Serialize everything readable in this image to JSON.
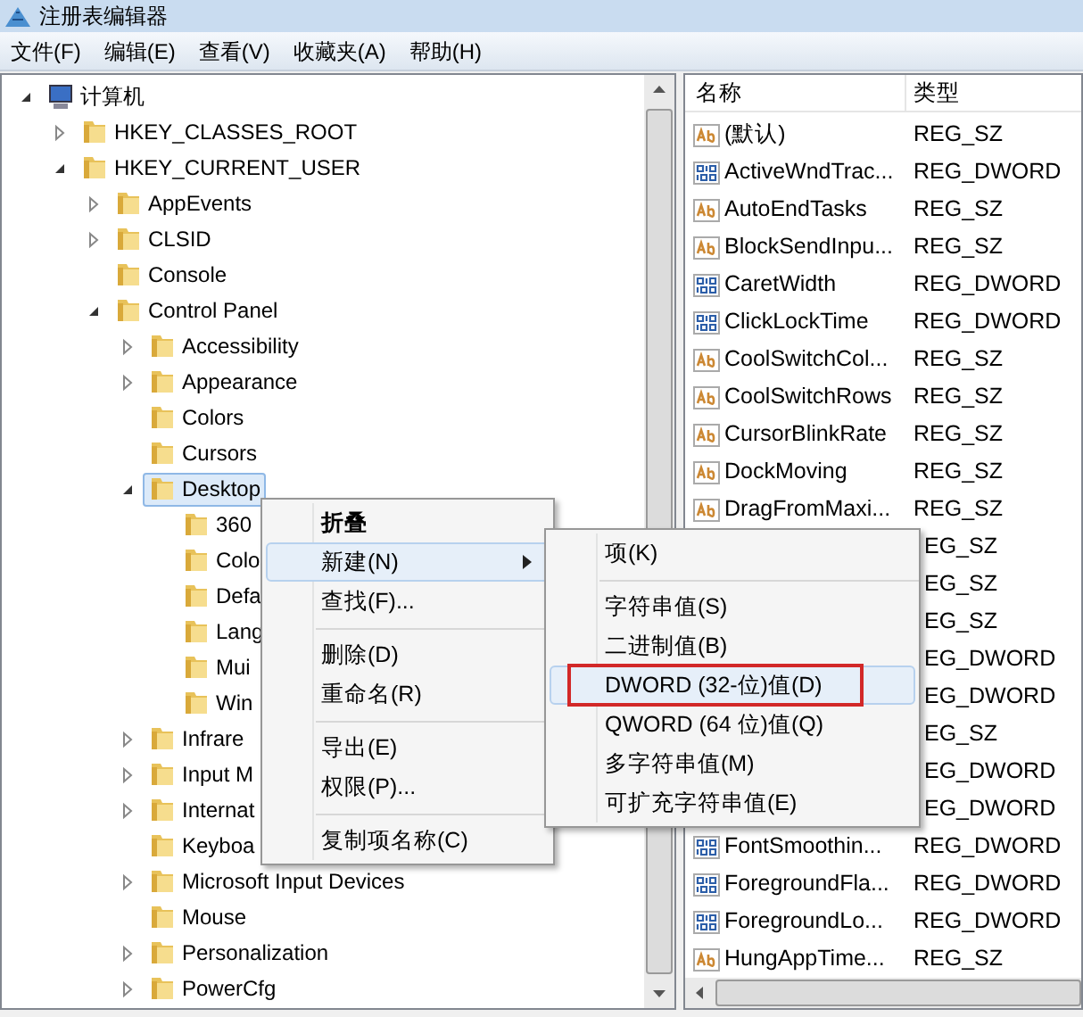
{
  "window": {
    "title": "注册表编辑器"
  },
  "menu_bar": [
    {
      "label": "文件(F)"
    },
    {
      "label": "编辑(E)"
    },
    {
      "label": "查看(V)"
    },
    {
      "label": "收藏夹(A)"
    },
    {
      "label": "帮助(H)"
    }
  ],
  "tree": [
    {
      "label": "计算机",
      "kind": "computer",
      "expandable": true,
      "expanded": true,
      "selected": false,
      "children": [
        {
          "label": "HKEY_CLASSES_ROOT",
          "kind": "folder",
          "expandable": true,
          "expanded": false,
          "selected": false
        },
        {
          "label": "HKEY_CURRENT_USER",
          "kind": "folder",
          "expandable": true,
          "expanded": true,
          "selected": false,
          "children": [
            {
              "label": "AppEvents",
              "kind": "folder",
              "expandable": true,
              "expanded": false,
              "selected": false
            },
            {
              "label": "CLSID",
              "kind": "folder",
              "expandable": true,
              "expanded": false,
              "selected": false
            },
            {
              "label": "Console",
              "kind": "folder",
              "expandable": false,
              "expanded": false,
              "selected": false
            },
            {
              "label": "Control Panel",
              "kind": "folder",
              "expandable": true,
              "expanded": true,
              "selected": false,
              "children": [
                {
                  "label": "Accessibility",
                  "kind": "folder",
                  "expandable": true,
                  "expanded": false,
                  "selected": false
                },
                {
                  "label": "Appearance",
                  "kind": "folder",
                  "expandable": true,
                  "expanded": false,
                  "selected": false
                },
                {
                  "label": "Colors",
                  "kind": "folder",
                  "expandable": false,
                  "expanded": false,
                  "selected": false
                },
                {
                  "label": "Cursors",
                  "kind": "folder",
                  "expandable": false,
                  "expanded": false,
                  "selected": false
                },
                {
                  "label": "Desktop",
                  "kind": "folder",
                  "expandable": true,
                  "expanded": true,
                  "selected": true,
                  "children": [
                    {
                      "label": "360",
                      "kind": "folder",
                      "expandable": false,
                      "expanded": false,
                      "selected": false
                    },
                    {
                      "label": "Colo",
                      "kind": "folder",
                      "expandable": false,
                      "expanded": false,
                      "selected": false
                    },
                    {
                      "label": "Defa",
                      "kind": "folder",
                      "expandable": false,
                      "expanded": false,
                      "selected": false
                    },
                    {
                      "label": "Lang",
                      "kind": "folder",
                      "expandable": false,
                      "expanded": false,
                      "selected": false
                    },
                    {
                      "label": "Mui",
                      "kind": "folder",
                      "expandable": false,
                      "expanded": false,
                      "selected": false
                    },
                    {
                      "label": "Win",
                      "kind": "folder",
                      "expandable": false,
                      "expanded": false,
                      "selected": false
                    }
                  ]
                },
                {
                  "label": "Infrare",
                  "kind": "folder",
                  "expandable": true,
                  "expanded": false,
                  "selected": false
                },
                {
                  "label": "Input M",
                  "kind": "folder",
                  "expandable": true,
                  "expanded": false,
                  "selected": false
                },
                {
                  "label": "Internat",
                  "kind": "folder",
                  "expandable": true,
                  "expanded": false,
                  "selected": false
                },
                {
                  "label": "Keyboa",
                  "kind": "folder",
                  "expandable": false,
                  "expanded": false,
                  "selected": false
                },
                {
                  "label": "Microsoft Input Devices",
                  "kind": "folder",
                  "expandable": true,
                  "expanded": false,
                  "selected": false
                },
                {
                  "label": "Mouse",
                  "kind": "folder",
                  "expandable": false,
                  "expanded": false,
                  "selected": false
                },
                {
                  "label": "Personalization",
                  "kind": "folder",
                  "expandable": true,
                  "expanded": false,
                  "selected": false
                },
                {
                  "label": "PowerCfg",
                  "kind": "folder",
                  "expandable": true,
                  "expanded": false,
                  "selected": false
                }
              ]
            }
          ]
        }
      ]
    }
  ],
  "values": {
    "columns": [
      "名称",
      "类型"
    ],
    "rows": [
      {
        "kind": "sz",
        "name": "(默认)",
        "type": "REG_SZ"
      },
      {
        "kind": "dword",
        "name": "ActiveWndTrac...",
        "type": "REG_DWORD"
      },
      {
        "kind": "sz",
        "name": "AutoEndTasks",
        "type": "REG_SZ"
      },
      {
        "kind": "sz",
        "name": "BlockSendInpu...",
        "type": "REG_SZ"
      },
      {
        "kind": "dword",
        "name": "CaretWidth",
        "type": "REG_DWORD"
      },
      {
        "kind": "dword",
        "name": "ClickLockTime",
        "type": "REG_DWORD"
      },
      {
        "kind": "sz",
        "name": "CoolSwitchCol...",
        "type": "REG_SZ"
      },
      {
        "kind": "sz",
        "name": "CoolSwitchRows",
        "type": "REG_SZ"
      },
      {
        "kind": "sz",
        "name": "CursorBlinkRate",
        "type": "REG_SZ"
      },
      {
        "kind": "sz",
        "name": "DockMoving",
        "type": "REG_SZ"
      },
      {
        "kind": "sz",
        "name": "DragFromMaxi...",
        "type": "REG_SZ"
      },
      {
        "kind": "covered",
        "type": "EG_SZ"
      },
      {
        "kind": "covered",
        "type": "EG_SZ"
      },
      {
        "kind": "covered",
        "type": "EG_SZ"
      },
      {
        "kind": "covered",
        "type": "EG_DWORD"
      },
      {
        "kind": "covered",
        "type": "EG_DWORD"
      },
      {
        "kind": "covered",
        "type": "EG_SZ"
      },
      {
        "kind": "covered",
        "type": "EG_DWORD"
      },
      {
        "kind": "covered",
        "type": "EG_DWORD"
      },
      {
        "kind": "dword",
        "name": "FontSmoothin...",
        "type": "REG_DWORD"
      },
      {
        "kind": "dword",
        "name": "ForegroundFla...",
        "type": "REG_DWORD"
      },
      {
        "kind": "dword",
        "name": "ForegroundLo...",
        "type": "REG_DWORD"
      },
      {
        "kind": "sz",
        "name": "HungAppTime...",
        "type": "REG_SZ"
      }
    ]
  },
  "context_menu": {
    "items": [
      {
        "kind": "item",
        "label": "折叠",
        "bold": true,
        "highlighted": false,
        "submenu": false
      },
      {
        "kind": "item",
        "label": "新建(N)",
        "bold": false,
        "highlighted": true,
        "submenu": true
      },
      {
        "kind": "item",
        "label": "查找(F)...",
        "bold": false,
        "highlighted": false,
        "submenu": false
      },
      {
        "kind": "separator"
      },
      {
        "kind": "item",
        "label": "删除(D)",
        "bold": false,
        "highlighted": false,
        "submenu": false
      },
      {
        "kind": "item",
        "label": "重命名(R)",
        "bold": false,
        "highlighted": false,
        "submenu": false
      },
      {
        "kind": "separator"
      },
      {
        "kind": "item",
        "label": "导出(E)",
        "bold": false,
        "highlighted": false,
        "submenu": false
      },
      {
        "kind": "item",
        "label": "权限(P)...",
        "bold": false,
        "highlighted": false,
        "submenu": false
      },
      {
        "kind": "separator"
      },
      {
        "kind": "item",
        "label": "复制项名称(C)",
        "bold": false,
        "highlighted": false,
        "submenu": false
      }
    ]
  },
  "submenu": {
    "items": [
      {
        "kind": "item",
        "label": "项(K)",
        "highlighted": false,
        "outlined": false
      },
      {
        "kind": "separator"
      },
      {
        "kind": "item",
        "label": "字符串值(S)",
        "highlighted": false,
        "outlined": false
      },
      {
        "kind": "item",
        "label": "二进制值(B)",
        "highlighted": false,
        "outlined": false
      },
      {
        "kind": "item",
        "label": "DWORD (32-位)值(D)",
        "highlighted": true,
        "outlined": true
      },
      {
        "kind": "item",
        "label": "QWORD (64 位)值(Q)",
        "highlighted": false,
        "outlined": false
      },
      {
        "kind": "item",
        "label": "多字符串值(M)",
        "highlighted": false,
        "outlined": false
      },
      {
        "kind": "item",
        "label": "可扩充字符串值(E)",
        "highlighted": false,
        "outlined": false
      }
    ]
  }
}
